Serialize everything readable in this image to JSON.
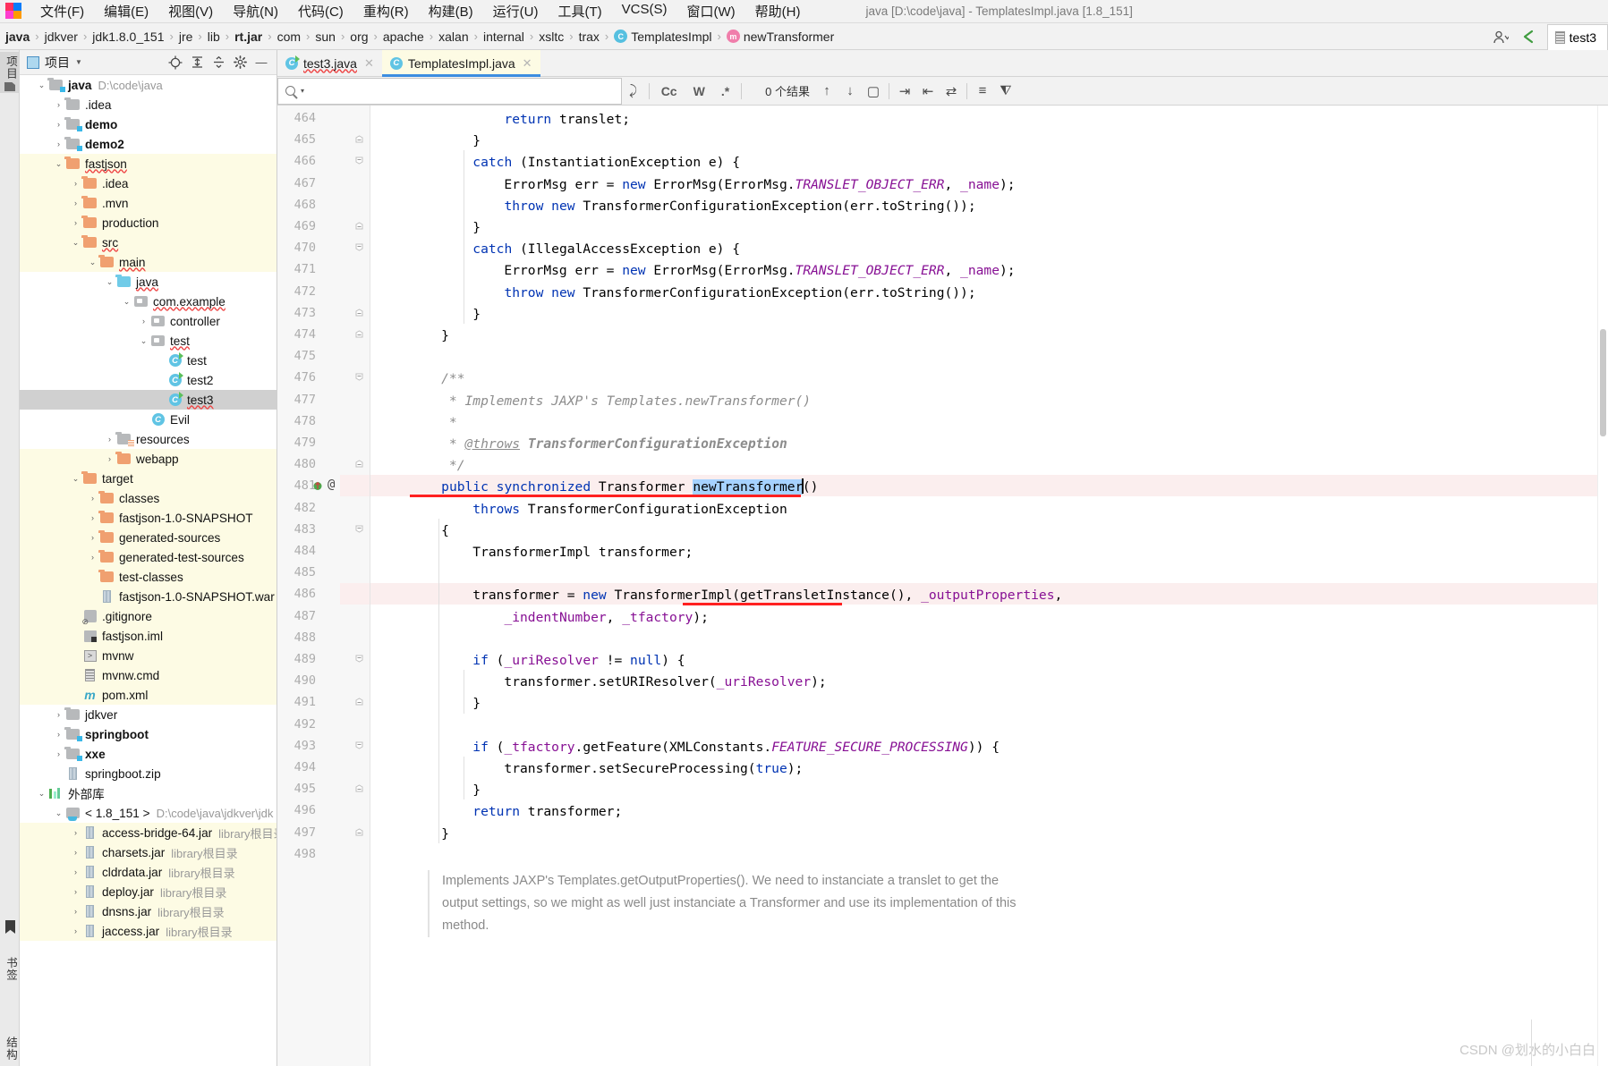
{
  "window": {
    "title": "java [D:\\code\\java] - TemplatesImpl.java [1.8_151]"
  },
  "menubar": {
    "items": [
      "文件(F)",
      "编辑(E)",
      "视图(V)",
      "导航(N)",
      "代码(C)",
      "重构(R)",
      "构建(B)",
      "运行(U)",
      "工具(T)",
      "VCS(S)",
      "窗口(W)",
      "帮助(H)"
    ]
  },
  "breadcrumb": {
    "items": [
      {
        "label": "java",
        "bold": true,
        "icon": ""
      },
      {
        "label": "jdkver",
        "bold": false,
        "icon": ""
      },
      {
        "label": "jdk1.8.0_151",
        "bold": false,
        "icon": ""
      },
      {
        "label": "jre",
        "bold": false,
        "icon": ""
      },
      {
        "label": "lib",
        "bold": false,
        "icon": ""
      },
      {
        "label": "rt.jar",
        "bold": true,
        "icon": ""
      },
      {
        "label": "com",
        "bold": false,
        "icon": ""
      },
      {
        "label": "sun",
        "bold": false,
        "icon": ""
      },
      {
        "label": "org",
        "bold": false,
        "icon": ""
      },
      {
        "label": "apache",
        "bold": false,
        "icon": ""
      },
      {
        "label": "xalan",
        "bold": false,
        "icon": ""
      },
      {
        "label": "internal",
        "bold": false,
        "icon": ""
      },
      {
        "label": "xsltc",
        "bold": false,
        "icon": ""
      },
      {
        "label": "trax",
        "bold": false,
        "icon": ""
      },
      {
        "label": "TemplatesImpl",
        "bold": false,
        "icon": "class"
      },
      {
        "label": "newTransformer",
        "bold": false,
        "icon": "method"
      }
    ],
    "right_tab_label": "test3"
  },
  "project_panel": {
    "title": "项目",
    "vertical_tabs": {
      "top": "项目",
      "bottom1": "书签",
      "bottom2": "结构"
    },
    "tree": [
      {
        "depth": 0,
        "arrow": "down",
        "icon": "folder-module",
        "label": "java",
        "bold": true,
        "path": "D:\\code\\java",
        "mod": false,
        "sel": false
      },
      {
        "depth": 1,
        "arrow": "right",
        "icon": "folder-gray",
        "label": ".idea",
        "bold": false,
        "path": "",
        "mod": false,
        "sel": false
      },
      {
        "depth": 1,
        "arrow": "right",
        "icon": "folder-module",
        "label": "demo",
        "bold": true,
        "path": "",
        "mod": false,
        "sel": false
      },
      {
        "depth": 1,
        "arrow": "right",
        "icon": "folder-module",
        "label": "demo2",
        "bold": true,
        "path": "",
        "mod": false,
        "sel": false
      },
      {
        "depth": 1,
        "arrow": "down",
        "icon": "folder-orange",
        "label": "fastjson",
        "bold": false,
        "path": "",
        "mod": true,
        "sel": false,
        "wave": true
      },
      {
        "depth": 2,
        "arrow": "right",
        "icon": "folder-orange",
        "label": ".idea",
        "bold": false,
        "path": "",
        "mod": true,
        "sel": false
      },
      {
        "depth": 2,
        "arrow": "right",
        "icon": "folder-orange",
        "label": ".mvn",
        "bold": false,
        "path": "",
        "mod": true,
        "sel": false
      },
      {
        "depth": 2,
        "arrow": "right",
        "icon": "folder-orange",
        "label": "production",
        "bold": false,
        "path": "",
        "mod": true,
        "sel": false
      },
      {
        "depth": 2,
        "arrow": "down",
        "icon": "folder-orange",
        "label": "src",
        "bold": false,
        "path": "",
        "mod": true,
        "sel": false,
        "wave": true
      },
      {
        "depth": 3,
        "arrow": "down",
        "icon": "folder-orange",
        "label": "main",
        "bold": false,
        "path": "",
        "mod": true,
        "sel": false,
        "wave": true
      },
      {
        "depth": 4,
        "arrow": "down",
        "icon": "folder-blue",
        "label": "java",
        "bold": false,
        "path": "",
        "mod": false,
        "sel": false,
        "wave": true
      },
      {
        "depth": 5,
        "arrow": "down",
        "icon": "package",
        "label": "com.example",
        "bold": false,
        "path": "",
        "mod": false,
        "sel": false,
        "wave": true
      },
      {
        "depth": 6,
        "arrow": "right",
        "icon": "package",
        "label": "controller",
        "bold": false,
        "path": "",
        "mod": false,
        "sel": false
      },
      {
        "depth": 6,
        "arrow": "down",
        "icon": "package",
        "label": "test",
        "bold": false,
        "path": "",
        "mod": false,
        "sel": false,
        "wave": true
      },
      {
        "depth": 7,
        "arrow": "none",
        "icon": "class-run",
        "label": "test",
        "bold": false,
        "path": "",
        "mod": false,
        "sel": false
      },
      {
        "depth": 7,
        "arrow": "none",
        "icon": "class-run",
        "label": "test2",
        "bold": false,
        "path": "",
        "mod": false,
        "sel": false
      },
      {
        "depth": 7,
        "arrow": "none",
        "icon": "class-run",
        "label": "test3",
        "bold": false,
        "path": "",
        "mod": false,
        "sel": true,
        "wave": true
      },
      {
        "depth": 6,
        "arrow": "none",
        "icon": "class",
        "label": "Evil",
        "bold": false,
        "path": "",
        "mod": false,
        "sel": false
      },
      {
        "depth": 4,
        "arrow": "right",
        "icon": "folder-res",
        "label": "resources",
        "bold": false,
        "path": "",
        "mod": false,
        "sel": false
      },
      {
        "depth": 4,
        "arrow": "right",
        "icon": "folder-orange",
        "label": "webapp",
        "bold": false,
        "path": "",
        "mod": true,
        "sel": false
      },
      {
        "depth": 2,
        "arrow": "down",
        "icon": "folder-orange",
        "label": "target",
        "bold": false,
        "path": "",
        "mod": true,
        "sel": false
      },
      {
        "depth": 3,
        "arrow": "right",
        "icon": "folder-orange",
        "label": "classes",
        "bold": false,
        "path": "",
        "mod": true,
        "sel": false
      },
      {
        "depth": 3,
        "arrow": "right",
        "icon": "folder-orange",
        "label": "fastjson-1.0-SNAPSHOT",
        "bold": false,
        "path": "",
        "mod": true,
        "sel": false
      },
      {
        "depth": 3,
        "arrow": "right",
        "icon": "folder-orange",
        "label": "generated-sources",
        "bold": false,
        "path": "",
        "mod": true,
        "sel": false
      },
      {
        "depth": 3,
        "arrow": "right",
        "icon": "folder-orange",
        "label": "generated-test-sources",
        "bold": false,
        "path": "",
        "mod": true,
        "sel": false
      },
      {
        "depth": 3,
        "arrow": "none",
        "icon": "folder-orange",
        "label": "test-classes",
        "bold": false,
        "path": "",
        "mod": true,
        "sel": false
      },
      {
        "depth": 3,
        "arrow": "none",
        "icon": "jar",
        "label": "fastjson-1.0-SNAPSHOT.war",
        "bold": false,
        "path": "",
        "mod": true,
        "sel": false
      },
      {
        "depth": 2,
        "arrow": "none",
        "icon": "gitignore",
        "label": ".gitignore",
        "bold": false,
        "path": "",
        "mod": true,
        "sel": false
      },
      {
        "depth": 2,
        "arrow": "none",
        "icon": "iml",
        "label": "fastjson.iml",
        "bold": false,
        "path": "",
        "mod": true,
        "sel": false
      },
      {
        "depth": 2,
        "arrow": "none",
        "icon": "script",
        "label": "mvnw",
        "bold": false,
        "path": "",
        "mod": true,
        "sel": false
      },
      {
        "depth": 2,
        "arrow": "none",
        "icon": "doc",
        "label": "mvnw.cmd",
        "bold": false,
        "path": "",
        "mod": true,
        "sel": false
      },
      {
        "depth": 2,
        "arrow": "none",
        "icon": "maven",
        "label": "pom.xml",
        "bold": false,
        "path": "",
        "mod": true,
        "sel": false
      },
      {
        "depth": 1,
        "arrow": "right",
        "icon": "folder-gray",
        "label": "jdkver",
        "bold": false,
        "path": "",
        "mod": false,
        "sel": false
      },
      {
        "depth": 1,
        "arrow": "right",
        "icon": "folder-module",
        "label": "springboot",
        "bold": true,
        "path": "",
        "mod": false,
        "sel": false
      },
      {
        "depth": 1,
        "arrow": "right",
        "icon": "folder-module",
        "label": "xxe",
        "bold": true,
        "path": "",
        "mod": false,
        "sel": false
      },
      {
        "depth": 1,
        "arrow": "none",
        "icon": "jar",
        "label": "springboot.zip",
        "bold": false,
        "path": "",
        "mod": false,
        "sel": false
      },
      {
        "depth": 0,
        "arrow": "down",
        "icon": "lib",
        "label": "外部库",
        "bold": false,
        "path": "",
        "mod": false,
        "sel": false
      },
      {
        "depth": 1,
        "arrow": "down",
        "icon": "sdk",
        "label": "< 1.8_151 >",
        "bold": false,
        "path": "D:\\code\\java\\jdkver\\jdk",
        "mod": false,
        "sel": false
      },
      {
        "depth": 2,
        "arrow": "right",
        "icon": "jar",
        "label": "access-bridge-64.jar",
        "bold": false,
        "path": "library根目录",
        "mod": true,
        "sel": false
      },
      {
        "depth": 2,
        "arrow": "right",
        "icon": "jar",
        "label": "charsets.jar",
        "bold": false,
        "path": "library根目录",
        "mod": true,
        "sel": false
      },
      {
        "depth": 2,
        "arrow": "right",
        "icon": "jar",
        "label": "cldrdata.jar",
        "bold": false,
        "path": "library根目录",
        "mod": true,
        "sel": false
      },
      {
        "depth": 2,
        "arrow": "right",
        "icon": "jar",
        "label": "deploy.jar",
        "bold": false,
        "path": "library根目录",
        "mod": true,
        "sel": false
      },
      {
        "depth": 2,
        "arrow": "right",
        "icon": "jar",
        "label": "dnsns.jar",
        "bold": false,
        "path": "library根目录",
        "mod": true,
        "sel": false
      },
      {
        "depth": 2,
        "arrow": "right",
        "icon": "jar",
        "label": "jaccess.jar",
        "bold": false,
        "path": "library根目录",
        "mod": true,
        "sel": false
      }
    ]
  },
  "editor": {
    "tabs": [
      {
        "label": "test3.java",
        "icon": "class-run",
        "active": false
      },
      {
        "label": "TemplatesImpl.java",
        "icon": "class",
        "active": true
      }
    ],
    "findbar": {
      "placeholder": "",
      "value": "",
      "options": [
        "Cc",
        "W",
        ".*"
      ],
      "result_count": "0 个结果"
    },
    "first_line_number": 464,
    "lines": [
      {
        "n": 464,
        "indent": 0,
        "fold": "",
        "gutter": [],
        "hl": false
      },
      {
        "n": 465,
        "indent": 0,
        "fold": "end",
        "gutter": [],
        "hl": false
      },
      {
        "n": 466,
        "indent": 0,
        "fold": "start",
        "gutter": [],
        "hl": false
      },
      {
        "n": 467,
        "indent": 0,
        "fold": "",
        "gutter": [],
        "hl": false
      },
      {
        "n": 468,
        "indent": 0,
        "fold": "",
        "gutter": [],
        "hl": false
      },
      {
        "n": 469,
        "indent": 0,
        "fold": "end",
        "gutter": [],
        "hl": false
      },
      {
        "n": 470,
        "indent": 0,
        "fold": "start",
        "gutter": [],
        "hl": false
      },
      {
        "n": 471,
        "indent": 0,
        "fold": "",
        "gutter": [],
        "hl": false
      },
      {
        "n": 472,
        "indent": 0,
        "fold": "",
        "gutter": [],
        "hl": false
      },
      {
        "n": 473,
        "indent": 0,
        "fold": "end",
        "gutter": [],
        "hl": false
      },
      {
        "n": 474,
        "indent": 0,
        "fold": "end",
        "gutter": [],
        "hl": false
      },
      {
        "n": 475,
        "indent": 0,
        "fold": "",
        "gutter": [],
        "hl": false
      },
      {
        "n": 476,
        "indent": 0,
        "fold": "start",
        "gutter": [],
        "hl": false
      },
      {
        "n": 477,
        "indent": 0,
        "fold": "",
        "gutter": [],
        "hl": false
      },
      {
        "n": 478,
        "indent": 0,
        "fold": "",
        "gutter": [],
        "hl": false
      },
      {
        "n": 479,
        "indent": 0,
        "fold": "",
        "gutter": [],
        "hl": false
      },
      {
        "n": 480,
        "indent": 0,
        "fold": "end",
        "gutter": [],
        "hl": false
      },
      {
        "n": 481,
        "indent": 0,
        "fold": "",
        "gutter": [
          "override",
          "implement",
          "annotation",
          "bookmark"
        ],
        "hl": true
      },
      {
        "n": 482,
        "indent": 0,
        "fold": "",
        "gutter": [],
        "hl": false
      },
      {
        "n": 483,
        "indent": 0,
        "fold": "start",
        "gutter": [],
        "hl": false
      },
      {
        "n": 484,
        "indent": 0,
        "fold": "",
        "gutter": [],
        "hl": false
      },
      {
        "n": 485,
        "indent": 0,
        "fold": "",
        "gutter": [],
        "hl": false
      },
      {
        "n": 486,
        "indent": 0,
        "fold": "",
        "gutter": [
          "breakpoint"
        ],
        "hl": true
      },
      {
        "n": 487,
        "indent": 0,
        "fold": "",
        "gutter": [],
        "hl": false
      },
      {
        "n": 488,
        "indent": 0,
        "fold": "",
        "gutter": [],
        "hl": false
      },
      {
        "n": 489,
        "indent": 0,
        "fold": "start",
        "gutter": [],
        "hl": false
      },
      {
        "n": 490,
        "indent": 0,
        "fold": "",
        "gutter": [],
        "hl": false
      },
      {
        "n": 491,
        "indent": 0,
        "fold": "end",
        "gutter": [],
        "hl": false
      },
      {
        "n": 492,
        "indent": 0,
        "fold": "",
        "gutter": [],
        "hl": false
      },
      {
        "n": 493,
        "indent": 0,
        "fold": "start",
        "gutter": [],
        "hl": false
      },
      {
        "n": 494,
        "indent": 0,
        "fold": "",
        "gutter": [],
        "hl": false
      },
      {
        "n": 495,
        "indent": 0,
        "fold": "end",
        "gutter": [],
        "hl": false
      },
      {
        "n": 496,
        "indent": 0,
        "fold": "",
        "gutter": [],
        "hl": false
      },
      {
        "n": 497,
        "indent": 0,
        "fold": "end",
        "gutter": [],
        "hl": false
      },
      {
        "n": 498,
        "indent": 0,
        "fold": "",
        "gutter": [],
        "hl": false
      }
    ],
    "code_text": [
      "            return translet;",
      "        }",
      "        catch (InstantiationException e) {",
      "            ErrorMsg err = new ErrorMsg(ErrorMsg.TRANSLET_OBJECT_ERR, _name);",
      "            throw new TransformerConfigurationException(err.toString());",
      "        }",
      "        catch (IllegalAccessException e) {",
      "            ErrorMsg err = new ErrorMsg(ErrorMsg.TRANSLET_OBJECT_ERR, _name);",
      "            throw new TransformerConfigurationException(err.toString());",
      "        }",
      "    }",
      "",
      "    /**",
      "     * Implements JAXP's Templates.newTransformer()",
      "     *",
      "     * @throws TransformerConfigurationException",
      "     */",
      "    public synchronized Transformer newTransformer()",
      "        throws TransformerConfigurationException",
      "    {",
      "        TransformerImpl transformer;",
      "",
      "        transformer = new TransformerImpl(getTransletInstance(), _outputProperties,",
      "            _indentNumber, _tfactory);",
      "",
      "        if (_uriResolver != null) {",
      "            transformer.setURIResolver(_uriResolver);",
      "        }",
      "",
      "        if (_tfactory.getFeature(XMLConstants.FEATURE_SECURE_PROCESSING)) {",
      "            transformer.setSecureProcessing(true);",
      "        }",
      "        return transformer;",
      "    }"
    ],
    "selected_token": "newTransformer",
    "doc_panel_text": "Implements JAXP's Templates.getOutputProperties(). We need to instanciate a translet to get the output settings, so we might as well just instanciate a Transformer and use its implementation of this method."
  },
  "watermark": "CSDN @划水的小白白",
  "colors": {
    "keyword": "#0033b3",
    "comment": "#8c8c8c",
    "constant": "#871094",
    "field": "#871094",
    "selection": "#a6d2ff",
    "error_underline": "#ff2020",
    "highlight_row": "#fbeeee",
    "module_bg": "#fdfbe4",
    "tree_selection": "#d0d0d0"
  }
}
